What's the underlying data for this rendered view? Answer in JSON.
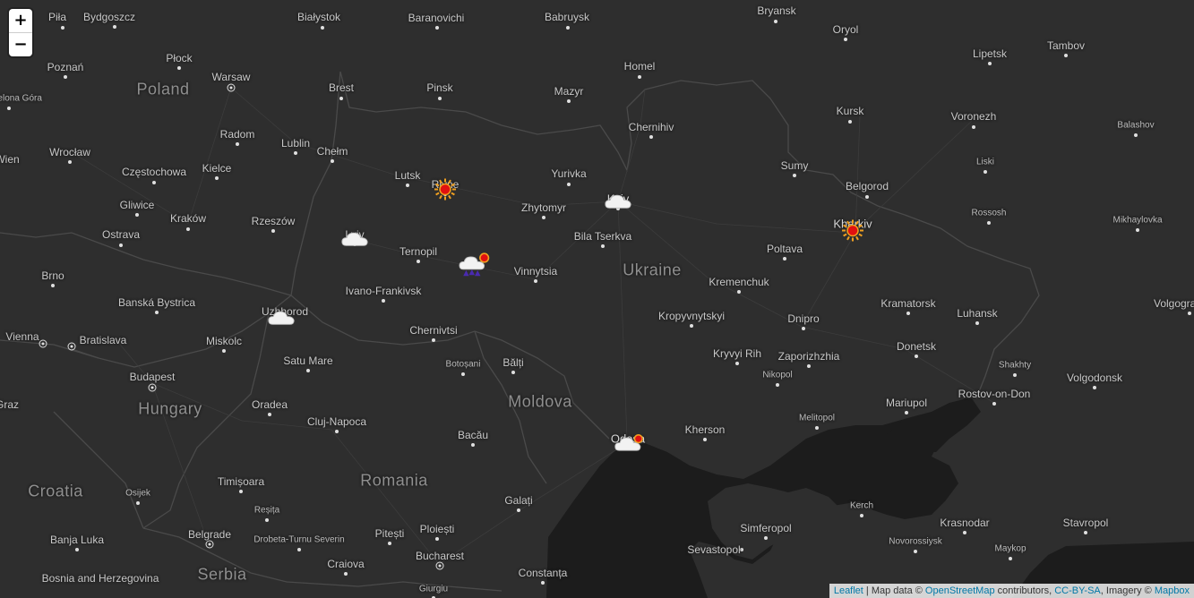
{
  "zoom": {
    "in_label": "+",
    "out_label": "−"
  },
  "attribution": {
    "leaflet": "Leaflet",
    "sep1": " | Map data © ",
    "osm": "OpenStreetMap",
    "contrib": " contributors, ",
    "license": "CC-BY-SA",
    "imagery": ", Imagery © ",
    "mapbox": "Mapbox"
  },
  "countries": [
    "Poland",
    "Ukraine",
    "Hungary",
    "Moldova",
    "Romania",
    "Croatia",
    "Serbia"
  ],
  "cities": [
    "Piła",
    "Bydgoszcz",
    "Białystok",
    "Baranovichi",
    "Babruysk",
    "Bryansk",
    "Oryol",
    "Tambov",
    "Płock",
    "Poznań",
    "Warsaw",
    "Lipetsk",
    "Homel",
    "Mazyr",
    "Pinsk",
    "Brest",
    "Zielona Góra",
    "Radom",
    "Lublin",
    "Chełm",
    "Chernihiv",
    "Kursk",
    "Voronezh",
    "Balashov",
    "Wrocław",
    "Częstochowa",
    "Kielce",
    "Lutsk",
    "Rivne",
    "Yurivka",
    "Sumy",
    "Liski",
    "Belgorod",
    "Gliwice",
    "Kraków",
    "Rzeszów",
    "Zhytomyr",
    "Kyiv",
    "Rossosh",
    "Ostrava",
    "Lviv",
    "Bila Tserkva",
    "Kharkiv",
    "Mikhaylovka",
    "Ternopil",
    "Vinnytsia",
    "Poltava",
    "Brno",
    "Banská Bystrica",
    "Ivano-Frankivsk",
    "Kremenchuk",
    "Kramatorsk",
    "Uzhhorod",
    "Kropyvnytskyi",
    "Dnipro",
    "Luhansk",
    "Volgograd",
    "Vienna",
    "Bratislava",
    "Miskolc",
    "Chernivtsi",
    "Kryvyi Rih",
    "Zaporizhzhia",
    "Donetsk",
    "Satu Mare",
    "Botoșani",
    "Bălți",
    "Nikopol",
    "Shakhty",
    "Volgodonsk",
    "Budapest",
    "Oradea",
    "Cluj-Napoca",
    "Mariupol",
    "Rostov-on-Don",
    "Melitopol",
    "Kherson",
    "Odesa",
    "Bacău",
    "Timișoara",
    "Osijek",
    "Galați",
    "Kerch",
    "Krasnodar",
    "Reșița",
    "Simferopol",
    "Stavropol",
    "Banja Luka",
    "Belgrade",
    "Drobeta-Turnu Severin",
    "Pitești",
    "Ploiești",
    "Novorossiysk",
    "Sevastopol",
    "Maykop",
    "Craiova",
    "Bucharest",
    "Constanța",
    "Giurgiu",
    "Bosnia and Herzegovina",
    "Graz",
    "Wien"
  ],
  "weather_icons": [
    {
      "city": "Rivne",
      "icon": "sun-icon"
    },
    {
      "city": "Kyiv",
      "icon": "cloud-icon"
    },
    {
      "city": "Lviv",
      "icon": "cloud-icon"
    },
    {
      "city": "Kharkiv",
      "icon": "sun-icon"
    },
    {
      "city": "Vinnytsia",
      "icon": "storm-sun-icon"
    },
    {
      "city": "Uzhhorod",
      "icon": "cloud-icon"
    },
    {
      "city": "Odesa",
      "icon": "cloud-sun-icon"
    }
  ],
  "colors": {
    "land": "#2e2e2e",
    "water": "#1c1c1c",
    "border": "#4a4a4a",
    "sun": "#e01010",
    "ray": "#f0a020"
  }
}
